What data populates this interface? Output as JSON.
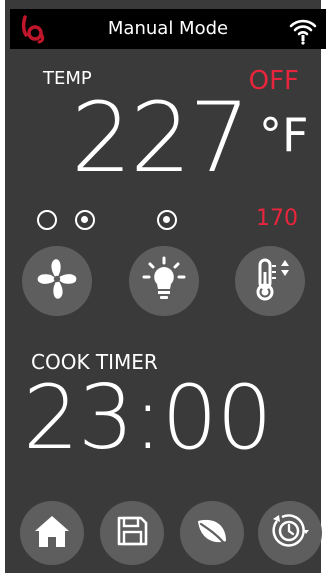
{
  "header": {
    "title": "Manual Mode",
    "logo_icon": "brand-logo-icon",
    "status_icon": "wifi-icon"
  },
  "temperature": {
    "label": "TEMP",
    "value": "227",
    "unit": "°F",
    "status": "OFF"
  },
  "fan": {
    "icon": "fan-icon",
    "indicators": [
      {
        "name": "fan-speed-low-indicator",
        "selected": false
      },
      {
        "name": "fan-speed-high-indicator",
        "selected": true
      }
    ]
  },
  "light": {
    "icon": "light-bulb-icon",
    "indicator_selected": true
  },
  "probe": {
    "icon": "thermometer-adjust-icon",
    "setpoint": "170"
  },
  "timer": {
    "label": "COOK TIMER",
    "value": "23:00"
  },
  "nav": {
    "items": [
      {
        "name": "home",
        "icon": "home-icon"
      },
      {
        "name": "save",
        "icon": "save-icon"
      },
      {
        "name": "leaf",
        "icon": "leaf-icon"
      },
      {
        "name": "timer-menu",
        "icon": "clock-rotate-icon"
      }
    ]
  },
  "colors": {
    "background": "#3a3a3a",
    "header": "#000000",
    "button": "#5e5e5e",
    "accent_red": "#e8253c",
    "text": "#ffffff"
  }
}
